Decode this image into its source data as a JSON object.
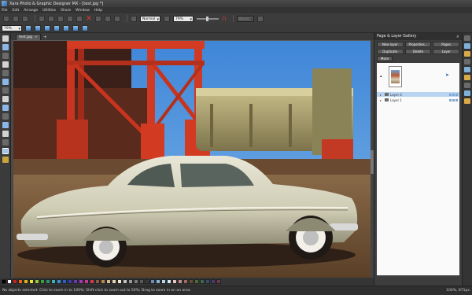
{
  "window": {
    "title": "Xara Photo & Graphic Designer MX - [test.jpg *]"
  },
  "menu": [
    "File",
    "Edit",
    "Arrange",
    "Utilities",
    "Share",
    "Window",
    "Help"
  ],
  "toolbar": {
    "zoom_mode": "Normal",
    "opacity": "79%",
    "disabled_field": "None",
    "zoom_value": "79%"
  },
  "document_tab": {
    "label": "test.jpg",
    "close": "×",
    "new_tab": "+"
  },
  "gallery": {
    "title": "Page & Layer Gallery",
    "close": "×",
    "buttons": [
      "New layer",
      "Properties...",
      "Pages",
      "Duplicate",
      "Delete",
      "Layer"
    ],
    "more_label": "More",
    "layers": [
      {
        "name": "Layer 2",
        "selected": true
      },
      {
        "name": "Layer 1",
        "selected": false
      }
    ]
  },
  "palette": {
    "colors": [
      "#000000",
      "#ffffff",
      "#cc2222",
      "#e06a1a",
      "#e3b21a",
      "#e8e23a",
      "#9ec93a",
      "#3aa03a",
      "#2f8f6e",
      "#3ab3b3",
      "#3a8fd6",
      "#2e5fc2",
      "#3a3ab3",
      "#6a3ab3",
      "#a43ab3",
      "#c23a8f",
      "#d63a5a",
      "#8a5a3a",
      "#b58a5a",
      "#d6b88a",
      "#e8d6b8",
      "#f0e8d6",
      "#c2c2c2",
      "#9a9a9a",
      "#7a7a7a",
      "#5a5a5a",
      "#3a3a3a",
      "#6a8fb5",
      "#8fb5d6",
      "#b5d6e8",
      "#d6e8f0",
      "#e8c2c2",
      "#c28f8f",
      "#a06a6a",
      "#6a4a3a",
      "#4a6a3a",
      "#3a6a4a",
      "#3a4a6a",
      "#4a3a6a",
      "#6a3a4a"
    ]
  },
  "status": {
    "text": "No objects selected: Click to zoom in to 100%; Shift-click to zoom out to 50%; Drag to zoom in on an area.",
    "right": "100%, 871px"
  }
}
